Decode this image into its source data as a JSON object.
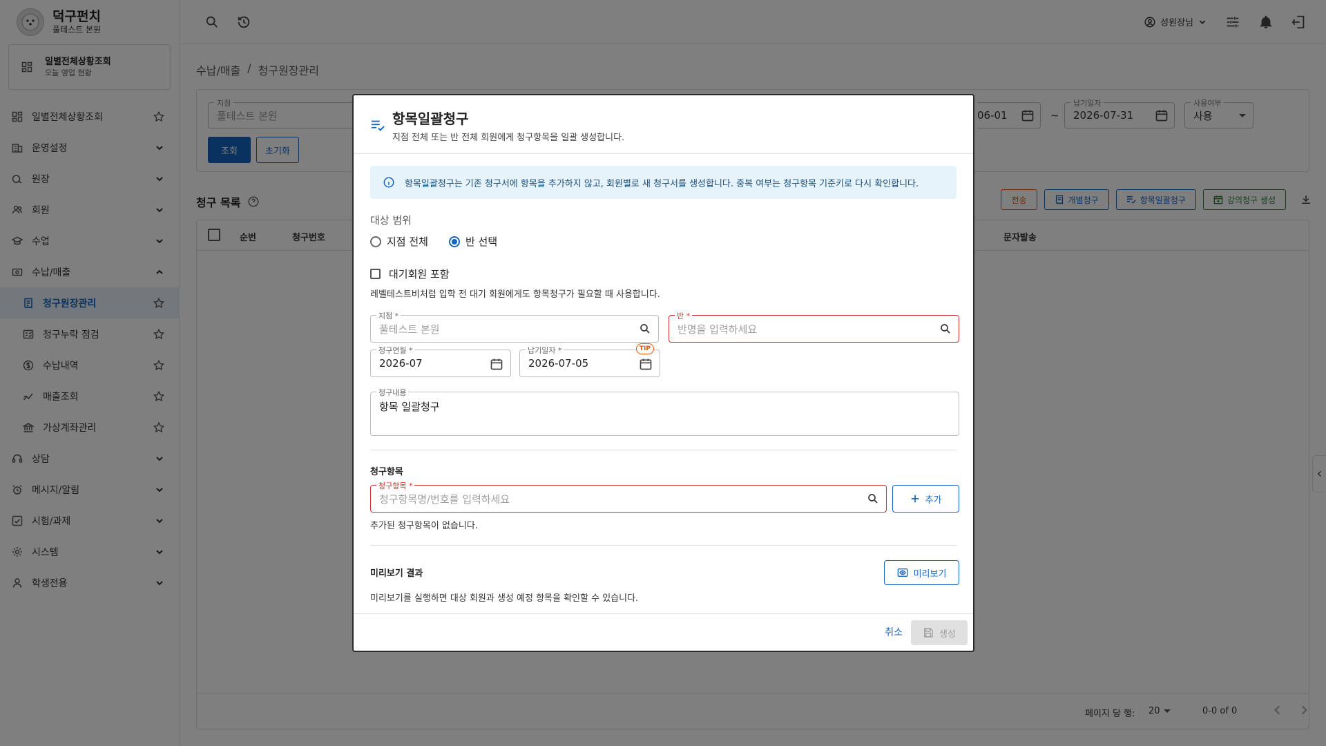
{
  "brand": {
    "title": "덕구펀치",
    "subtitle": "풀테스트 본원"
  },
  "quick_access": {
    "title": "일별전체상황조회",
    "subtitle": "오늘 영업 현황"
  },
  "sidebar": {
    "items": [
      {
        "label": "일별전체상황조회",
        "icon": "dashboard-icon",
        "trail": "star"
      },
      {
        "label": "운영설정",
        "icon": "building-icon",
        "trail": "chevron-down"
      },
      {
        "label": "원장",
        "icon": "ledger-icon",
        "trail": "chevron-down"
      },
      {
        "label": "회원",
        "icon": "users-icon",
        "trail": "chevron-down"
      },
      {
        "label": "수업",
        "icon": "graduation-icon",
        "trail": "chevron-down"
      },
      {
        "label": "수납/매출",
        "icon": "cash-icon",
        "trail": "chevron-up"
      },
      {
        "label": "청구원장관리",
        "icon": "receipt-icon",
        "trail": "star",
        "sub": true,
        "active": true
      },
      {
        "label": "청구누락 점검",
        "icon": "checklist-icon",
        "trail": "star",
        "sub": true
      },
      {
        "label": "수납내역",
        "icon": "dollar-icon",
        "trail": "star",
        "sub": true
      },
      {
        "label": "매출조회",
        "icon": "chart-line-icon",
        "trail": "star",
        "sub": true
      },
      {
        "label": "가상계좌관리",
        "icon": "bank-icon",
        "trail": "star",
        "sub": true
      },
      {
        "label": "상담",
        "icon": "headset-icon",
        "trail": "chevron-down"
      },
      {
        "label": "메시지/알림",
        "icon": "alarm-icon",
        "trail": "chevron-down"
      },
      {
        "label": "시험/과제",
        "icon": "task-icon",
        "trail": "chevron-down"
      },
      {
        "label": "시스템",
        "icon": "gear-icon",
        "trail": "chevron-down"
      },
      {
        "label": "학생전용",
        "icon": "person-icon",
        "trail": "chevron-down"
      }
    ]
  },
  "topbar": {
    "user": "성원장님"
  },
  "breadcrumb": {
    "parent": "수납/매출",
    "sep": "/",
    "current": "청구원장관리"
  },
  "filter": {
    "branch_label": "지점",
    "branch_value": "풀테스트 본원",
    "date_from_partial": "06-01",
    "range_sep": "~",
    "due_label": "납기일자",
    "due_value": "2026-07-31",
    "use_label": "사용여부",
    "use_value": "사용",
    "search_btn": "조회",
    "reset_btn": "초기화"
  },
  "list": {
    "title": "청구 목록",
    "actions": {
      "send": "전송",
      "individual": "개별청구",
      "bulk": "항목일괄청구",
      "lecture": "강의청구 생성"
    },
    "columns": {
      "seq": "순번",
      "number": "청구번호",
      "sms": "문자발송"
    },
    "footer": {
      "rows_label": "페이지 당 행:",
      "rows_value": "20",
      "range": "0-0 of 0"
    }
  },
  "modal": {
    "title": "항목일괄청구",
    "subtitle": "지점 전체 또는 반 전체 회원에게 청구항목을 일괄 생성합니다.",
    "info": "항목일괄청구는 기존 청구서에 항목을 추가하지 않고, 회원별로 새 청구서를 생성합니다. 중복 여부는 청구항목 기준키로 다시 확인합니다.",
    "scope_label": "대상 범위",
    "scope_all": "지점 전체",
    "scope_class": "반 선택",
    "waitlist_label": "대기회원 포함",
    "waitlist_help": "레벨테스트비처럼 입학 전 대기 회원에게도 항목청구가 필요할 때 사용합니다.",
    "branch": {
      "label": "지점 *",
      "placeholder": "풀테스트 본원"
    },
    "class": {
      "label": "반 *",
      "placeholder": "반명을 입력하세요"
    },
    "bill_month": {
      "label": "청구연월 *",
      "value": "2026-07"
    },
    "due_date": {
      "label": "납기일자 *",
      "value": "2026-07-05",
      "tip": "TIP"
    },
    "content": {
      "label": "청구내용",
      "value": "항목 일괄청구"
    },
    "items_section": "청구항목",
    "item_field": {
      "label": "청구항목 *",
      "placeholder": "청구항목명/번호를 입력하세요"
    },
    "add_btn": "추가",
    "empty_items": "추가된 청구항목이 없습니다.",
    "preview_section": "미리보기 결과",
    "preview_btn": "미리보기",
    "preview_help": "미리보기를 실행하면 대상 회원과 생성 예정 항목을 확인할 수 있습니다.",
    "cancel_btn": "취소",
    "create_btn": "생성"
  },
  "colors": {
    "primary": "#1565c0",
    "error": "#d32f2f",
    "info_bg": "#e6f3fb",
    "warning": "#e65100",
    "success": "#2e7d32"
  }
}
